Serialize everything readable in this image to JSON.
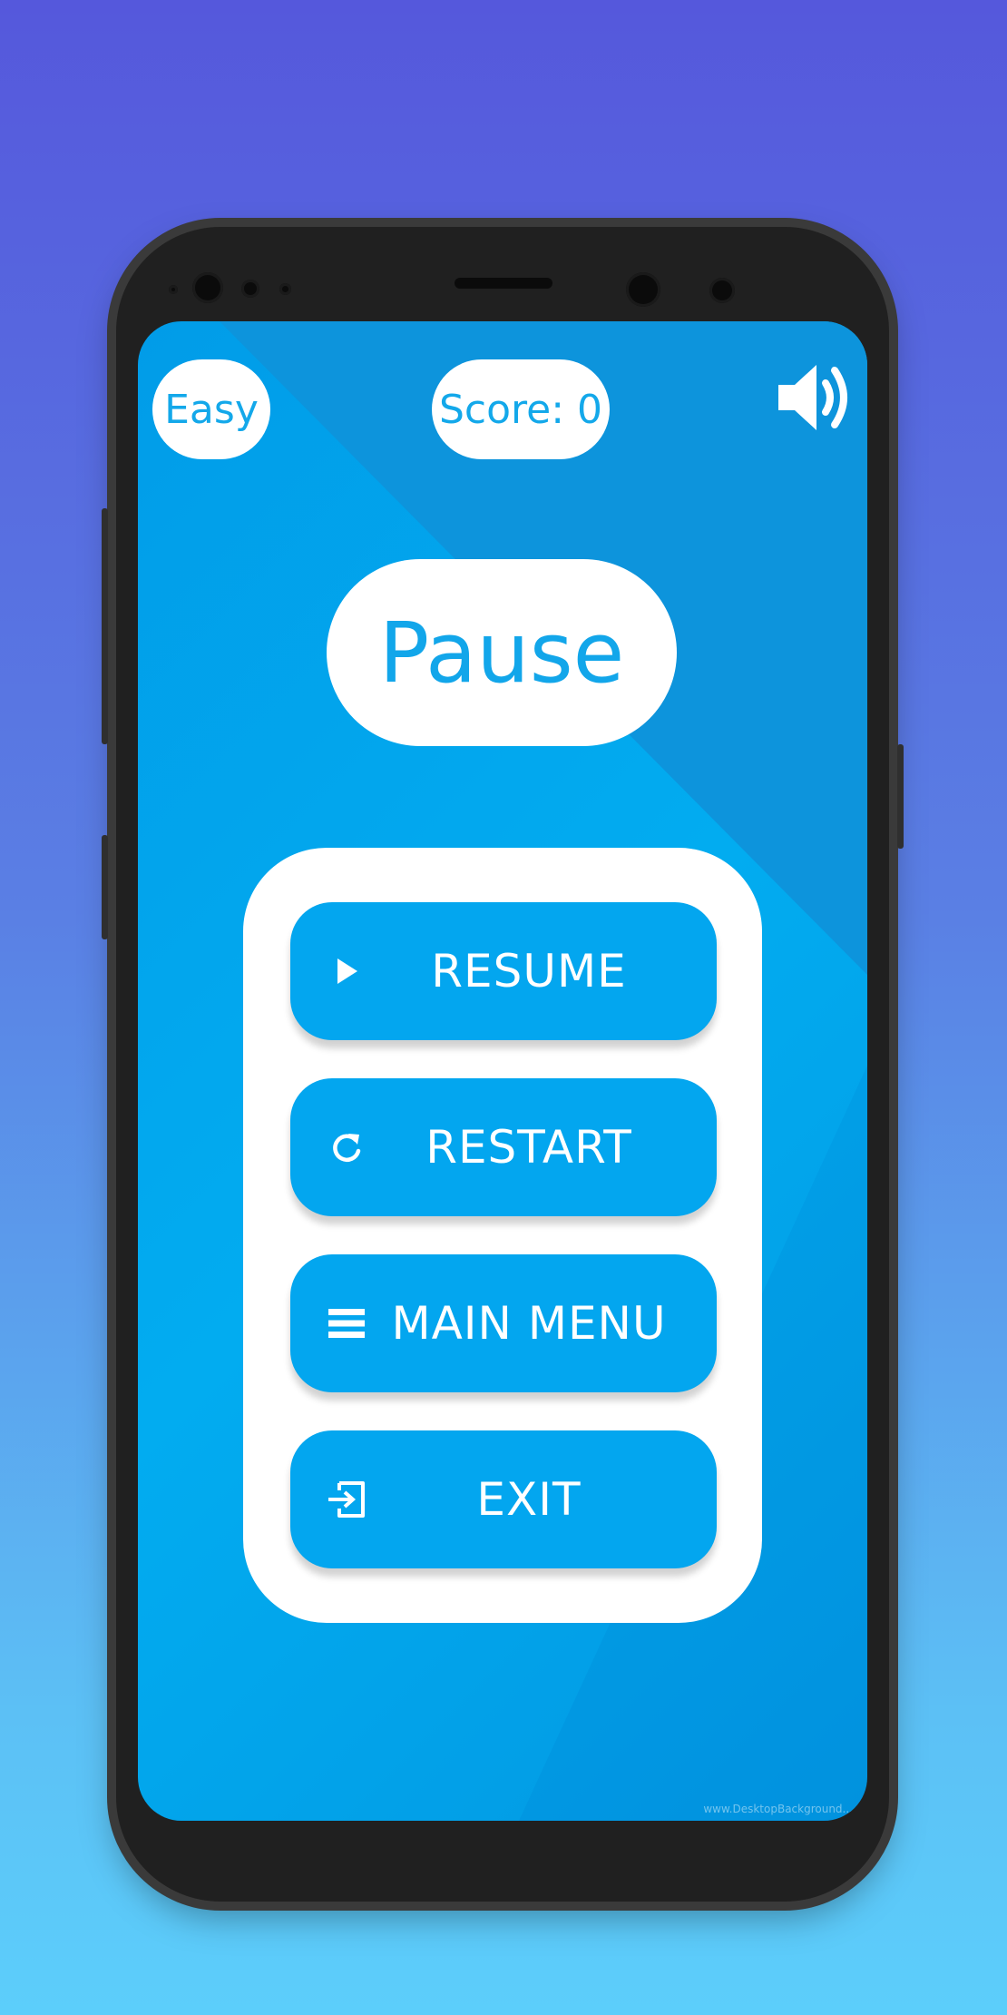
{
  "header": {
    "difficulty": "Easy",
    "score": "Score: 0",
    "sound_icon": "speaker-on-icon"
  },
  "title": "Pause",
  "menu": {
    "items": [
      {
        "label": "RESUME",
        "icon": "play-icon"
      },
      {
        "label": "RESTART",
        "icon": "restart-icon"
      },
      {
        "label": "MAIN MENU",
        "icon": "menu-icon"
      },
      {
        "label": "EXIT",
        "icon": "exit-icon"
      }
    ]
  },
  "colors": {
    "accent": "#03a6ef",
    "panel": "#ffffff",
    "text_on_accent": "#ffffff"
  },
  "watermark": "www.DesktopBackground..."
}
